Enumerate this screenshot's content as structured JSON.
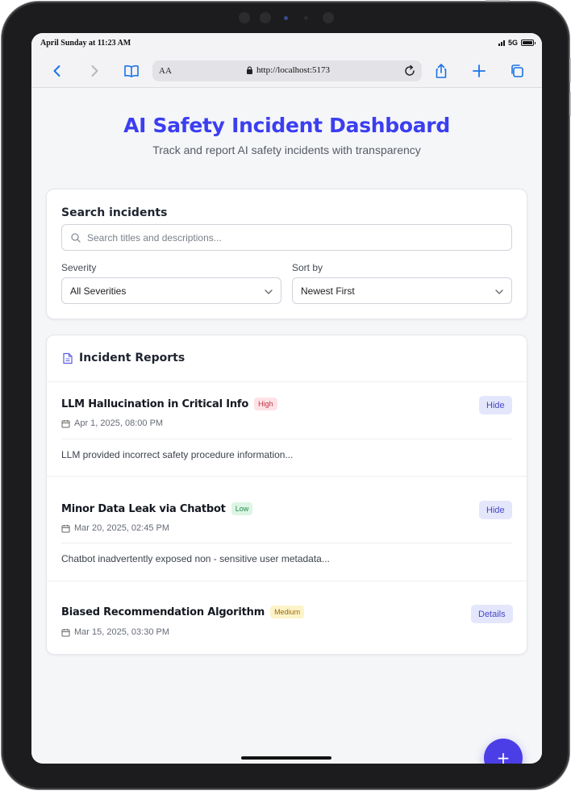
{
  "status_bar": {
    "time": "April Sunday at 11:23 AM",
    "network": "5G"
  },
  "browser": {
    "aa_label": "AA",
    "url": "http://localhost:5173"
  },
  "page": {
    "title": "AI Safety Incident Dashboard",
    "subtitle": "Track and report AI safety incidents with transparency"
  },
  "search": {
    "heading": "Search incidents",
    "placeholder": "Search titles and descriptions...",
    "severity_label": "Severity",
    "severity_value": "All Severities",
    "sort_label": "Sort by",
    "sort_value": "Newest First"
  },
  "reports": {
    "heading": "Incident Reports",
    "incidents": [
      {
        "title": "LLM Hallucination in Critical Info",
        "severity": "High",
        "date": "Apr 1, 2025, 08:00 PM",
        "description": "LLM provided incorrect safety procedure information...",
        "action": "Hide"
      },
      {
        "title": "Minor Data Leak via Chatbot",
        "severity": "Low",
        "date": "Mar 20, 2025, 02:45 PM",
        "description": "Chatbot inadvertently exposed non - sensitive user metadata...",
        "action": "Hide"
      },
      {
        "title": "Biased Recommendation Algorithm",
        "severity": "Medium",
        "date": "Mar 15, 2025, 03:30 PM",
        "action": "Details"
      }
    ]
  },
  "fab": {
    "label": "+"
  },
  "colors": {
    "accent": "#3b3ef0",
    "fab": "#4b3ee6",
    "browser_blue": "#1a73e8",
    "high": "#c2334a",
    "low": "#238a4a",
    "medium": "#9a6b12"
  }
}
